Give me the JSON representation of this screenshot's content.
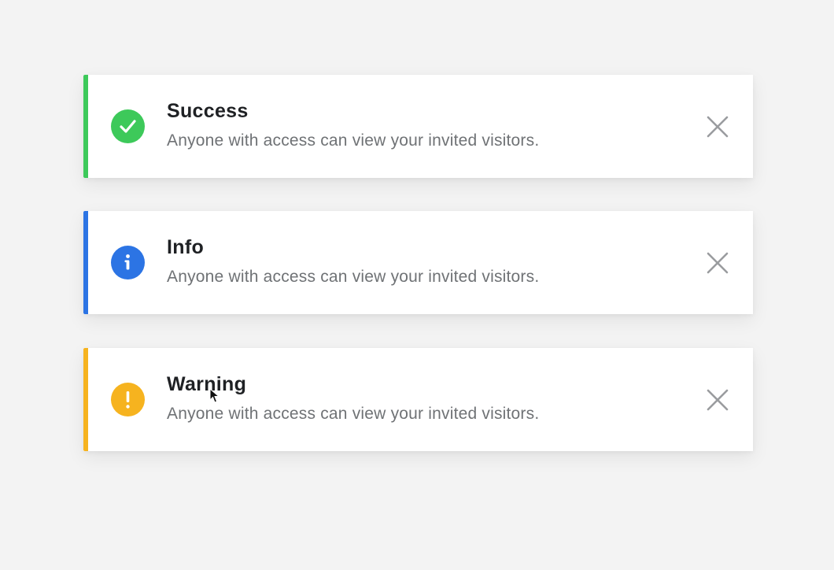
{
  "toasts": [
    {
      "type": "success",
      "title": "Success",
      "message": "Anyone with access can view your invited visitors.",
      "accent_color": "#3dc95a",
      "icon": "check-circle-icon",
      "icon_glyph": "✓",
      "close_icon": "close-icon"
    },
    {
      "type": "info",
      "title": "Info",
      "message": "Anyone with access can view your invited visitors.",
      "accent_color": "#2c74e4",
      "icon": "info-circle-icon",
      "icon_glyph": "i",
      "close_icon": "close-icon"
    },
    {
      "type": "warning",
      "title": "Warning",
      "message": "Anyone with access can view your invited visitors.",
      "accent_color": "#f6b31f",
      "icon": "warning-circle-icon",
      "icon_glyph": "!",
      "close_icon": "close-icon"
    }
  ],
  "colors": {
    "background": "#f3f3f3",
    "card": "#ffffff",
    "title_text": "#1f2124",
    "message_text": "#6f7275",
    "close_icon": "#9a9c9f"
  }
}
